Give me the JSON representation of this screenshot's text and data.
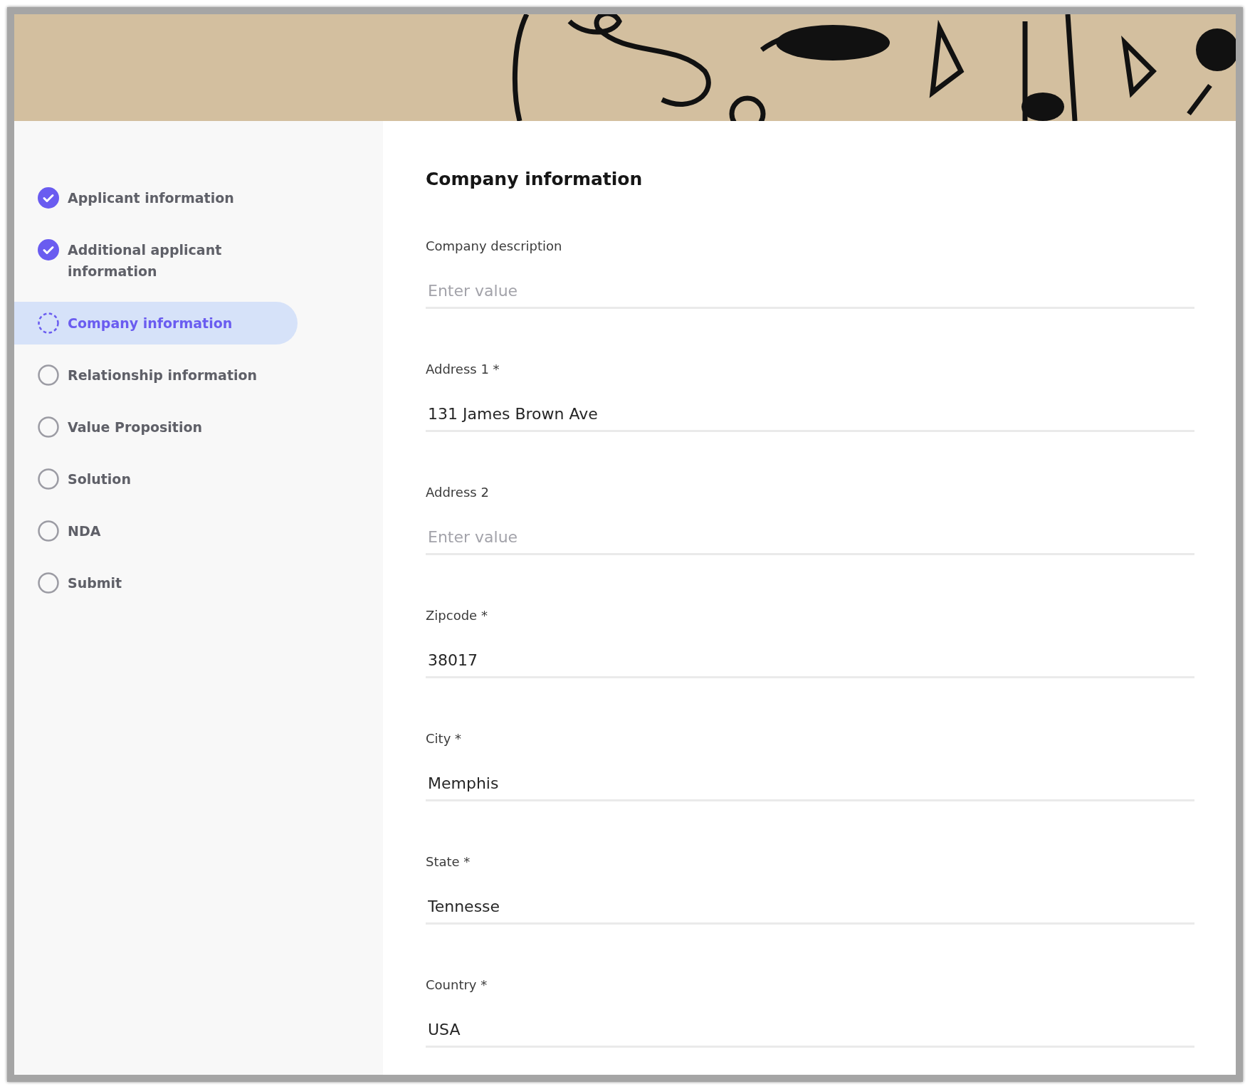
{
  "steps": [
    {
      "label": "Applicant information",
      "kind": "done",
      "selected": false
    },
    {
      "label": "Additional applicant information",
      "kind": "done",
      "selected": false
    },
    {
      "label": "Company information",
      "kind": "current",
      "selected": true
    },
    {
      "label": "Relationship information",
      "kind": "todo",
      "selected": false
    },
    {
      "label": "Value Proposition",
      "kind": "todo",
      "selected": false
    },
    {
      "label": "Solution",
      "kind": "todo",
      "selected": false
    },
    {
      "label": "NDA",
      "kind": "todo",
      "selected": false
    },
    {
      "label": "Submit",
      "kind": "todo",
      "selected": false
    }
  ],
  "form": {
    "title": "Company information",
    "fields": [
      {
        "label": "Company description",
        "placeholder": "Enter value"
      },
      {
        "label": "Address 1 *",
        "value": "131 James Brown Ave"
      },
      {
        "label": "Address 2",
        "placeholder": "Enter value"
      },
      {
        "label": "Zipcode *",
        "value": "38017"
      },
      {
        "label": "City *",
        "value": "Memphis"
      },
      {
        "label": "State *",
        "value": "Tennesse"
      },
      {
        "label": "Country *",
        "value": "USA"
      }
    ]
  }
}
